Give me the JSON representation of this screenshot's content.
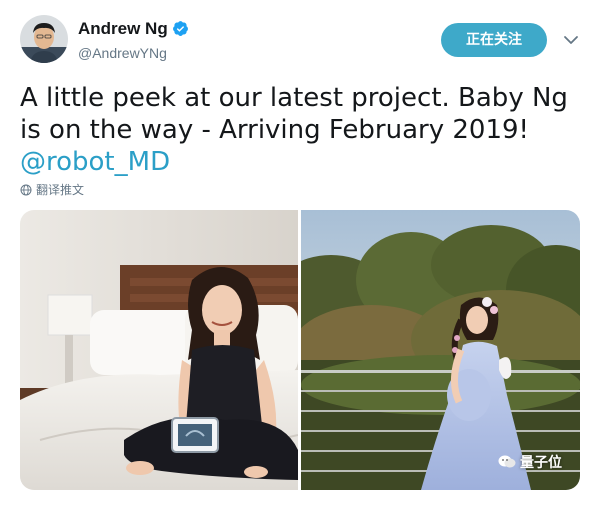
{
  "user": {
    "name": "Andrew Ng",
    "handle": "@AndrewYNg",
    "verified": true
  },
  "follow_button": {
    "label": "正在关注"
  },
  "tweet": {
    "text_plain": "A little peek at our latest project. Baby Ng is on the way - Arriving February 2019!",
    "mention": "@robot_MD"
  },
  "translate_label": "翻译推文",
  "watermark": "量子位",
  "colors": {
    "accent": "#3ea9c9",
    "link": "#2b9fc7",
    "verified": "#1da1f2"
  },
  "icons": [
    "verified-badge-icon",
    "chevron-down-icon",
    "globe-icon",
    "wechat-icon"
  ]
}
